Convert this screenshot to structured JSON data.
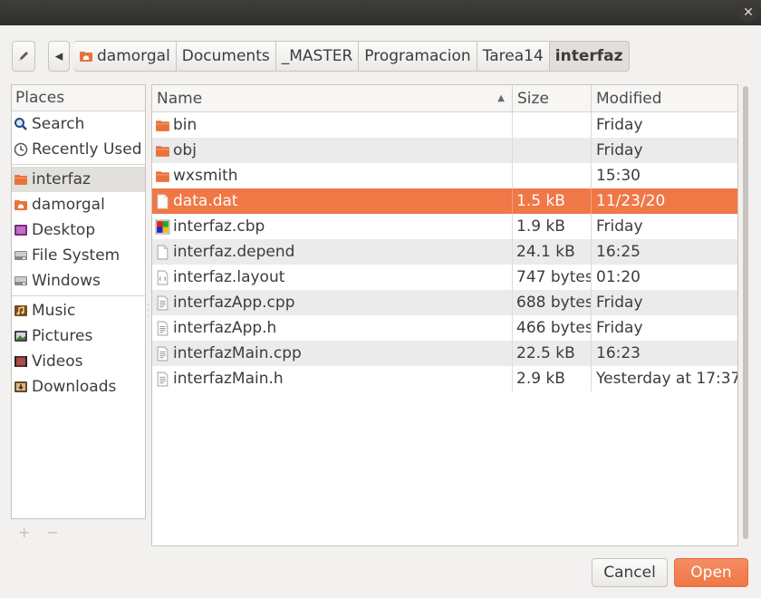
{
  "window": {
    "close_glyph": "✕"
  },
  "toolbar": {
    "edit_icon": "pencil-icon",
    "back_glyph": "◂",
    "crumbs": [
      {
        "label": "damorgal",
        "icon": "home-icon"
      },
      {
        "label": "Documents"
      },
      {
        "label": "_MASTER"
      },
      {
        "label": "Programacion"
      },
      {
        "label": "Tarea14"
      },
      {
        "label": "interfaz",
        "active": true
      }
    ]
  },
  "places": {
    "header": "Places",
    "items": [
      {
        "label": "Search",
        "icon": "search-icon"
      },
      {
        "label": "Recently Used",
        "icon": "clock-icon"
      },
      {
        "label": "interfaz",
        "icon": "folder-icon",
        "selected": true
      },
      {
        "label": "damorgal",
        "icon": "home-folder-icon"
      },
      {
        "label": "Desktop",
        "icon": "desktop-icon"
      },
      {
        "label": "File System",
        "icon": "drive-icon"
      },
      {
        "label": "Windows",
        "icon": "drive-icon"
      },
      {
        "label": "Music",
        "icon": "music-icon"
      },
      {
        "label": "Pictures",
        "icon": "pictures-icon"
      },
      {
        "label": "Videos",
        "icon": "videos-icon"
      },
      {
        "label": "Downloads",
        "icon": "downloads-icon"
      }
    ],
    "add_glyph": "+",
    "remove_glyph": "−"
  },
  "files": {
    "columns": {
      "name": "Name",
      "size": "Size",
      "modified": "Modified"
    },
    "sort_glyph": "▲",
    "rows": [
      {
        "name": "bin",
        "size": "",
        "modified": "Friday",
        "icon": "folder-icon"
      },
      {
        "name": "obj",
        "size": "",
        "modified": "Friday",
        "icon": "folder-icon"
      },
      {
        "name": "wxsmith",
        "size": "",
        "modified": "15:30",
        "icon": "folder-icon"
      },
      {
        "name": "data.dat",
        "size": "1.5 kB",
        "modified": "11/23/20",
        "icon": "file-icon",
        "selected": true
      },
      {
        "name": "interfaz.cbp",
        "size": "1.9 kB",
        "modified": "Friday",
        "icon": "project-file-icon"
      },
      {
        "name": "interfaz.depend",
        "size": "24.1 kB",
        "modified": "16:25",
        "icon": "file-icon"
      },
      {
        "name": "interfaz.layout",
        "size": "747 bytes",
        "modified": "01:20",
        "icon": "xml-file-icon"
      },
      {
        "name": "interfazApp.cpp",
        "size": "688 bytes",
        "modified": "Friday",
        "icon": "text-file-icon"
      },
      {
        "name": "interfazApp.h",
        "size": "466 bytes",
        "modified": "Friday",
        "icon": "text-file-icon"
      },
      {
        "name": "interfazMain.cpp",
        "size": "22.5 kB",
        "modified": "16:23",
        "icon": "text-file-icon"
      },
      {
        "name": "interfazMain.h",
        "size": "2.9 kB",
        "modified": "Yesterday at 17:37",
        "icon": "text-file-icon"
      }
    ]
  },
  "actions": {
    "cancel": "Cancel",
    "open": "Open"
  },
  "colors": {
    "accent": "#f07746",
    "folder": "#e8733b"
  }
}
